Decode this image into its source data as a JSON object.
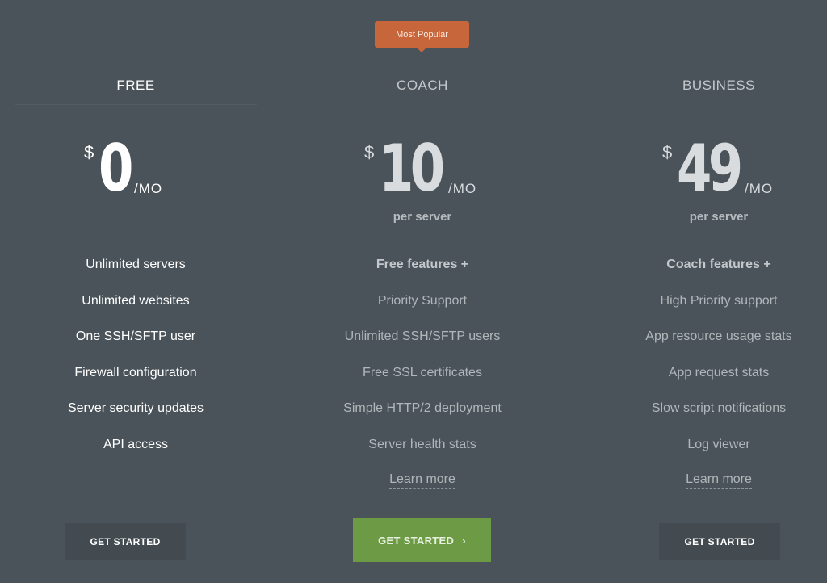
{
  "badge": {
    "label": "Most Popular",
    "color": "#c8663b"
  },
  "plans": [
    {
      "name": "FREE",
      "currency": "$",
      "amount": "0",
      "period": "/MO",
      "unit": "",
      "features": [
        "Unlimited servers",
        "Unlimited websites",
        "One SSH/SFTP user",
        "Firewall configuration",
        "Server security updates",
        "API access"
      ],
      "cta": "GET STARTED"
    },
    {
      "name": "COACH",
      "currency": "$",
      "amount": "10",
      "period": "/MO",
      "unit": "per server",
      "features": [
        "Free features +",
        "Priority Support",
        "Unlimited SSH/SFTP users",
        "Free SSL certificates",
        "Simple HTTP/2 deployment",
        "Server health stats"
      ],
      "learn_more": "Learn more",
      "cta": "GET STARTED",
      "cta_icon": "chevron-right-icon",
      "cta_color": "#6d9a45"
    },
    {
      "name": "BUSINESS",
      "currency": "$",
      "amount": "49",
      "period": "/MO",
      "unit": "per server",
      "features": [
        "Coach features +",
        "High Priority support",
        "App resource usage stats",
        "App request stats",
        "Slow script notifications",
        "Log viewer"
      ],
      "learn_more": "Learn more",
      "cta": "GET STARTED"
    }
  ]
}
